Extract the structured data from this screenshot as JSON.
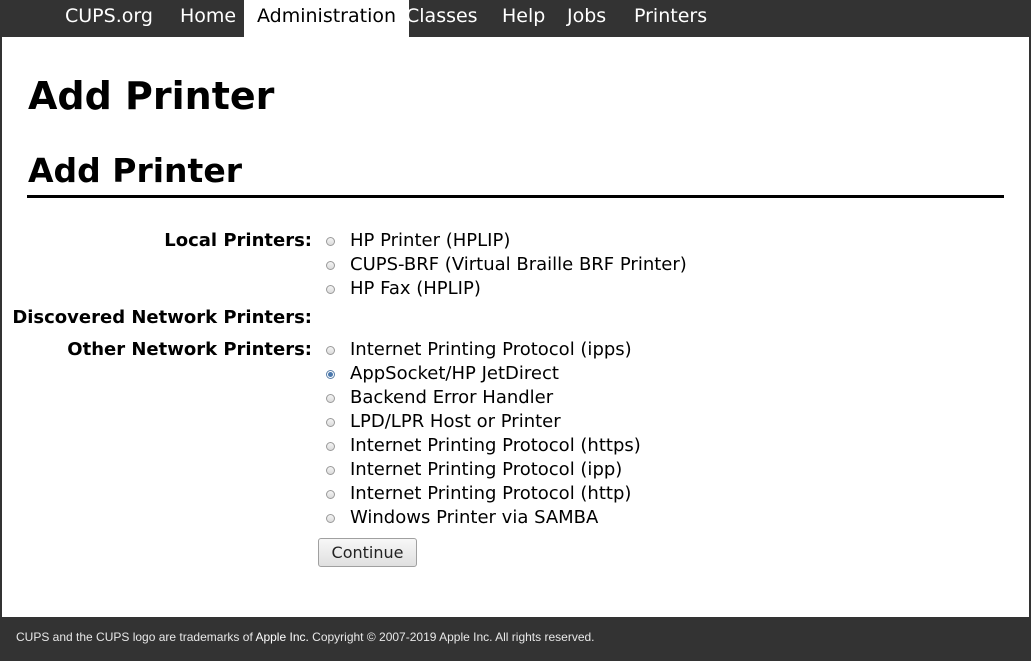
{
  "nav": {
    "items": [
      {
        "label": "CUPS.org"
      },
      {
        "label": "Home"
      },
      {
        "label": "Administration",
        "active": true
      },
      {
        "label": "Classes"
      },
      {
        "label": "Help"
      },
      {
        "label": "Jobs"
      },
      {
        "label": "Printers"
      }
    ]
  },
  "page": {
    "title": "Add Printer",
    "subtitle": "Add Printer"
  },
  "form": {
    "local_label": "Local Printers:",
    "local_options": [
      {
        "label": "HP Printer (HPLIP)",
        "checked": false
      },
      {
        "label": "CUPS-BRF (Virtual Braille BRF Printer)",
        "checked": false
      },
      {
        "label": "HP Fax (HPLIP)",
        "checked": false
      }
    ],
    "discovered_label": "Discovered Network Printers:",
    "other_label": "Other Network Printers:",
    "other_options": [
      {
        "label": "Internet Printing Protocol (ipps)",
        "checked": false
      },
      {
        "label": "AppSocket/HP JetDirect",
        "checked": true
      },
      {
        "label": "Backend Error Handler",
        "checked": false
      },
      {
        "label": "LPD/LPR Host or Printer",
        "checked": false
      },
      {
        "label": "Internet Printing Protocol (https)",
        "checked": false
      },
      {
        "label": "Internet Printing Protocol (ipp)",
        "checked": false
      },
      {
        "label": "Internet Printing Protocol (http)",
        "checked": false
      },
      {
        "label": "Windows Printer via SAMBA",
        "checked": false
      }
    ],
    "continue_label": "Continue"
  },
  "footer": {
    "text_before": "CUPS and the CUPS logo are trademarks of ",
    "link": "Apple Inc.",
    "text_after": " Copyright © 2007-2019 Apple Inc. All rights reserved."
  },
  "colors": {
    "nav_bg": "#333333",
    "footer_bg": "#333333",
    "radio_checked": "#4a78ad"
  }
}
